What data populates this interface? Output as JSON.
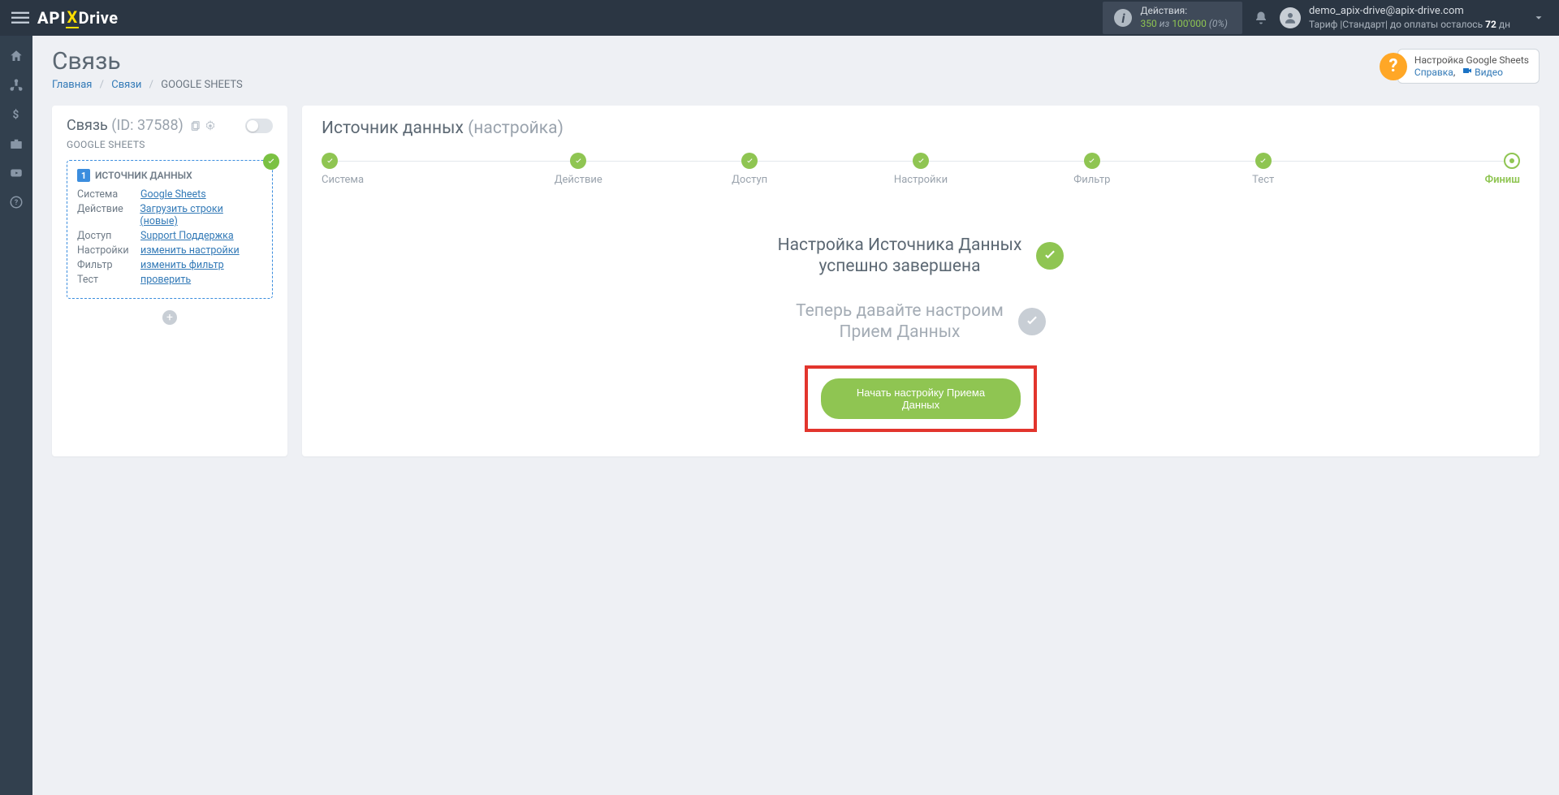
{
  "header": {
    "logo_api": "API",
    "logo_x": "X",
    "logo_drive": "Drive",
    "actions_label": "Действия:",
    "actions_used": "350",
    "actions_of": "из",
    "actions_total": "100'000",
    "actions_pct": "(0%)",
    "email": "demo_apix-drive@apix-drive.com",
    "tariff_prefix": "Тариф |Стандарт| до оплаты осталось ",
    "tariff_days": "72",
    "tariff_suffix": " дн"
  },
  "page": {
    "title": "Связь",
    "crumb_home": "Главная",
    "crumb_links": "Связи",
    "crumb_current": "GOOGLE SHEETS"
  },
  "help": {
    "title": "Настройка Google Sheets",
    "ref": "Справка",
    "video": "Видео"
  },
  "sidepanel": {
    "title": "Связь",
    "id_label": "(ID: 37588)",
    "sub": "GOOGLE SHEETS",
    "source_head": "ИСТОЧНИК ДАННЫХ",
    "rows": [
      {
        "label": "Система",
        "value": "Google Sheets"
      },
      {
        "label": "Действие",
        "value": "Загрузить строки (новые)"
      },
      {
        "label": "Доступ",
        "value": "Support Поддержка"
      },
      {
        "label": "Настройки",
        "value": "изменить настройки"
      },
      {
        "label": "Фильтр",
        "value": "изменить фильтр"
      },
      {
        "label": "Тест",
        "value": "проверить"
      }
    ]
  },
  "main": {
    "head": "Источник данных",
    "head_sub": "(настройка)",
    "steps": [
      "Система",
      "Действие",
      "Доступ",
      "Настройки",
      "Фильтр",
      "Тест",
      "Финиш"
    ],
    "status1_line1": "Настройка Источника Данных",
    "status1_line2": "успешно завершена",
    "status2_line1": "Теперь давайте настроим",
    "status2_line2": "Прием Данных",
    "cta": "Начать настройку Приема Данных"
  }
}
